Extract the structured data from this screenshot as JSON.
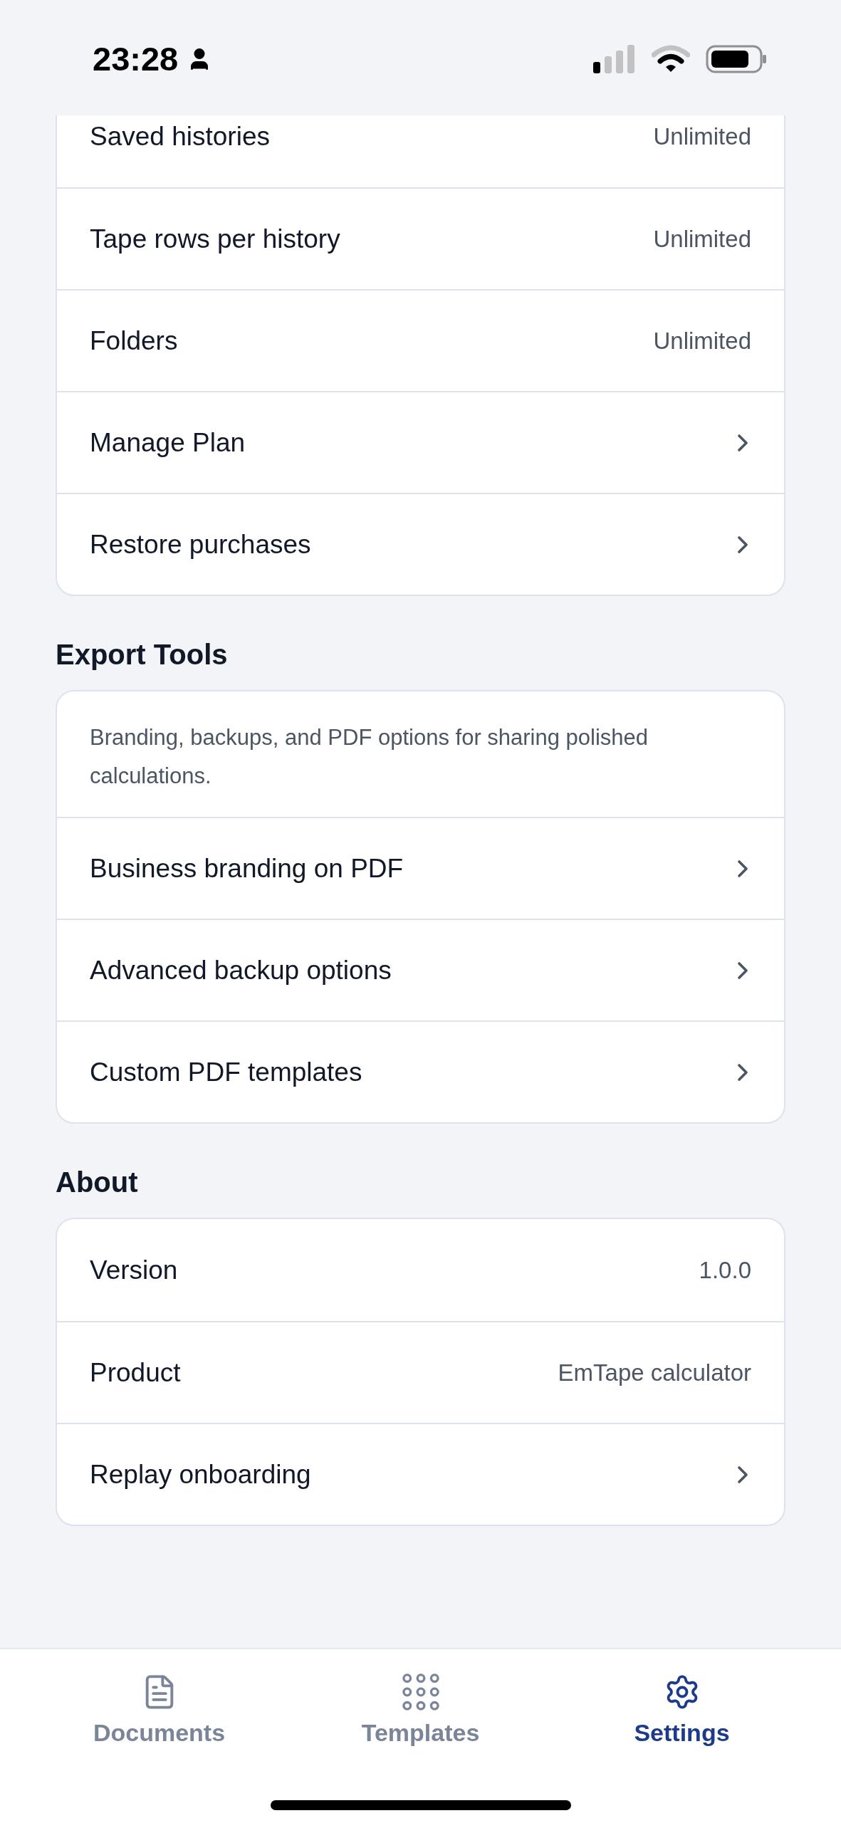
{
  "status_bar": {
    "time": "23:28"
  },
  "sections": [
    {
      "rows": [
        {
          "kind": "value",
          "label": "Saved histories",
          "value": "Unlimited"
        },
        {
          "kind": "value",
          "label": "Tape rows per history",
          "value": "Unlimited"
        },
        {
          "kind": "value",
          "label": "Folders",
          "value": "Unlimited"
        },
        {
          "kind": "link",
          "label": "Manage Plan"
        },
        {
          "kind": "link",
          "label": "Restore purchases"
        }
      ]
    },
    {
      "title": "Export Tools",
      "description": "Branding, backups, and PDF options for sharing polished calculations.",
      "rows": [
        {
          "kind": "link",
          "label": "Business branding on PDF"
        },
        {
          "kind": "link",
          "label": "Advanced backup options"
        },
        {
          "kind": "link",
          "label": "Custom PDF templates"
        }
      ]
    },
    {
      "title": "About",
      "rows": [
        {
          "kind": "value",
          "label": "Version",
          "value": "1.0.0"
        },
        {
          "kind": "value",
          "label": "Product",
          "value": "EmTape calculator"
        },
        {
          "kind": "link",
          "label": "Replay onboarding"
        }
      ]
    }
  ],
  "tab_bar": [
    {
      "kind": "document",
      "label": "Documents",
      "selected": false
    },
    {
      "kind": "grid",
      "label": "Templates",
      "selected": false
    },
    {
      "kind": "gear",
      "label": "Settings",
      "selected": true
    }
  ]
}
